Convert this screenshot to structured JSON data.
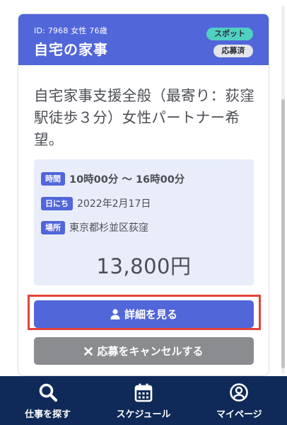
{
  "job": {
    "meta": "ID: 7968 女性 76歳",
    "title": "自宅の家事",
    "badge_spot": "スポット",
    "badge_applied": "応募済",
    "description": "自宅家事支援全般（最寄り：荻窪駅徒歩３分）女性パートナー希望。",
    "time_label": "時間",
    "time_value": "10時00分 〜 16時00分",
    "date_label": "日にち",
    "date_value": "2022年2月17日",
    "place_label": "場所",
    "place_value": "東京都杉並区荻窪",
    "price": "13,800円"
  },
  "actions": {
    "detail_label": "詳細を見る",
    "cancel_label": "応募をキャンセルする"
  },
  "nav": {
    "items": [
      {
        "label": "仕事を探す",
        "icon": "search-icon"
      },
      {
        "label": "スケジュール",
        "icon": "calendar-icon"
      },
      {
        "label": "マイページ",
        "icon": "user-circle-icon"
      }
    ]
  },
  "colors": {
    "primary": "#5166d9",
    "accent_spot": "#4fd1c0",
    "cancel_gray": "#8a8c8f",
    "nav_bg": "#0f2a58",
    "highlight": "#e3433a"
  }
}
